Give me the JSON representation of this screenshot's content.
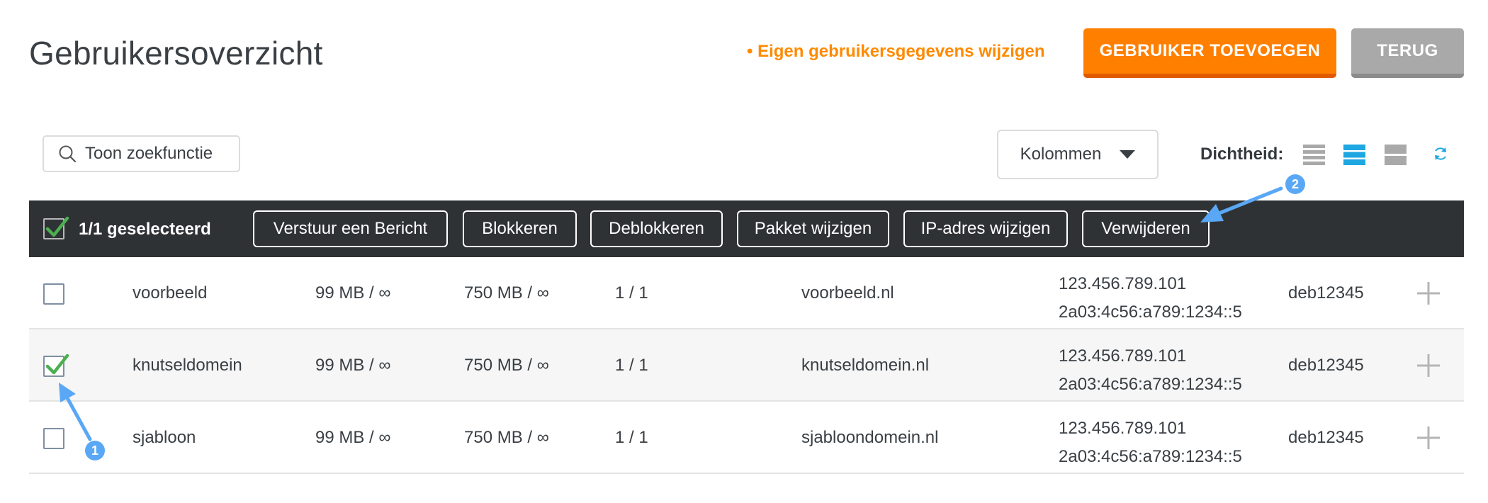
{
  "header": {
    "title": "Gebruikersoverzicht",
    "own_link": "• Eigen gebruikersgegevens wijzigen",
    "add_button": "GEBRUIKER TOEVOEGEN",
    "back_button": "TERUG"
  },
  "toolbar": {
    "search_label": "Toon zoekfunctie",
    "columns_label": "Kolommen",
    "density_label": "Dichtheid:",
    "density_active": "normal"
  },
  "action_bar": {
    "selected_text": "1/1 geselecteerd",
    "buttons": [
      "Verstuur een Bericht",
      "Blokkeren",
      "Deblokkeren",
      "Pakket wijzigen",
      "IP-adres wijzigen",
      "Verwijderen"
    ]
  },
  "rows": [
    {
      "checked": false,
      "name": "voorbeeld",
      "disk": "99 MB / ∞",
      "traffic": "750 MB / ∞",
      "count": "1 / 1",
      "domain": "voorbeeld.nl",
      "ipv4": "123.456.789.101",
      "ipv6": "2a03:4c56:a789:1234::5",
      "package": "deb12345"
    },
    {
      "checked": true,
      "name": "knutseldomein",
      "disk": "99 MB / ∞",
      "traffic": "750 MB / ∞",
      "count": "1 / 1",
      "domain": "knutseldomein.nl",
      "ipv4": "123.456.789.101",
      "ipv6": "2a03:4c56:a789:1234::5",
      "package": "deb12345"
    },
    {
      "checked": false,
      "name": "sjabloon",
      "disk": "99 MB / ∞",
      "traffic": "750 MB / ∞",
      "count": "1 / 1",
      "domain": "sjabloondomein.nl",
      "ipv4": "123.456.789.101",
      "ipv6": "2a03:4c56:a789:1234::5",
      "package": "deb12345"
    }
  ],
  "annotations": [
    {
      "number": "1"
    },
    {
      "number": "2"
    }
  ],
  "colors": {
    "accent_orange": "#ff7f00",
    "check_green": "#4caf50",
    "annotation_blue": "#5aa8f5",
    "action_bar_bg": "#2f3235",
    "density_active": "#1ea7e1"
  }
}
